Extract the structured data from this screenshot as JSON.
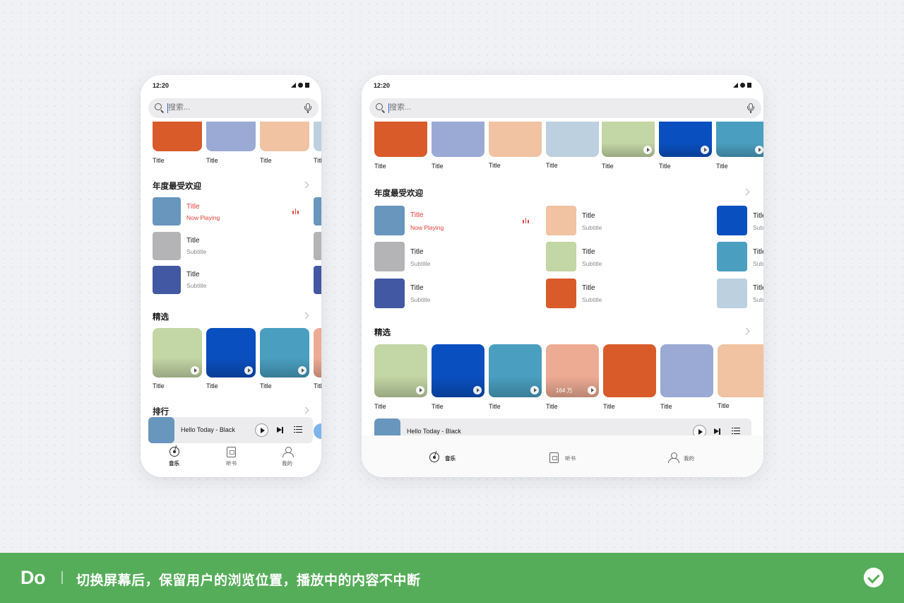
{
  "status": {
    "time": "12:20"
  },
  "search": {
    "placeholder": "搜索..."
  },
  "sections": {
    "popular": "年度最受欢迎",
    "featured": "精选",
    "ranking": "排行"
  },
  "tile_label": "Title",
  "colors": {
    "orange": "#d95b2a",
    "lavender": "#9aaad4",
    "peach": "#f1c3a2",
    "pale_blue": "#bdd0df",
    "sage": "#c3d6a5",
    "royal_blue": "#0a4fc0",
    "teal": "#4a9fc0",
    "salmon": "#eeab93",
    "steel_blue": "#6896bd",
    "gray": "#b4b4b6",
    "indigo": "#4358a3",
    "accent_red": "#e0403a",
    "banner_green": "#56ad59"
  },
  "popular_list": [
    {
      "title": "Title",
      "subtitle": "Now Playing",
      "color": "steel_blue",
      "playing": true
    },
    {
      "title": "Title",
      "subtitle": "Subtitle",
      "color": "gray",
      "playing": false
    },
    {
      "title": "Title",
      "subtitle": "Subtitle",
      "color": "indigo",
      "playing": false
    },
    {
      "title": "Title",
      "subtitle": "Subtitle",
      "color": "peach",
      "playing": false
    },
    {
      "title": "Title",
      "subtitle": "Subtitle",
      "color": "sage",
      "playing": false
    },
    {
      "title": "Title",
      "subtitle": "Subtitle",
      "color": "orange",
      "playing": false
    },
    {
      "title": "Title",
      "subtitle": "Subtitle",
      "color": "royal_blue",
      "playing": false
    },
    {
      "title": "Title",
      "subtitle": "Subtitle",
      "color": "teal",
      "playing": false
    },
    {
      "title": "Title",
      "subtitle": "Subtitle",
      "color": "pale_blue",
      "playing": false
    }
  ],
  "top_row_tiles": [
    "orange",
    "lavender",
    "peach",
    "pale_blue",
    "sage",
    "royal_blue",
    "teal"
  ],
  "featured_tiles": [
    "sage",
    "royal_blue",
    "teal",
    "salmon",
    "orange",
    "lavender",
    "peach"
  ],
  "featured_count": "164 万",
  "now_playing": {
    "track": "Hello Today - Black"
  },
  "tabs": [
    {
      "label": "音乐",
      "icon": "music-disc-icon",
      "active": true
    },
    {
      "label": "听书",
      "icon": "audiobook-icon",
      "active": false
    },
    {
      "label": "我的",
      "icon": "profile-icon",
      "active": false
    }
  ],
  "banner": {
    "tag": "Do",
    "text": "切换屏幕后，保留用户的浏览位置，播放中的内容不中断",
    "icon": "check-circle-icon"
  }
}
